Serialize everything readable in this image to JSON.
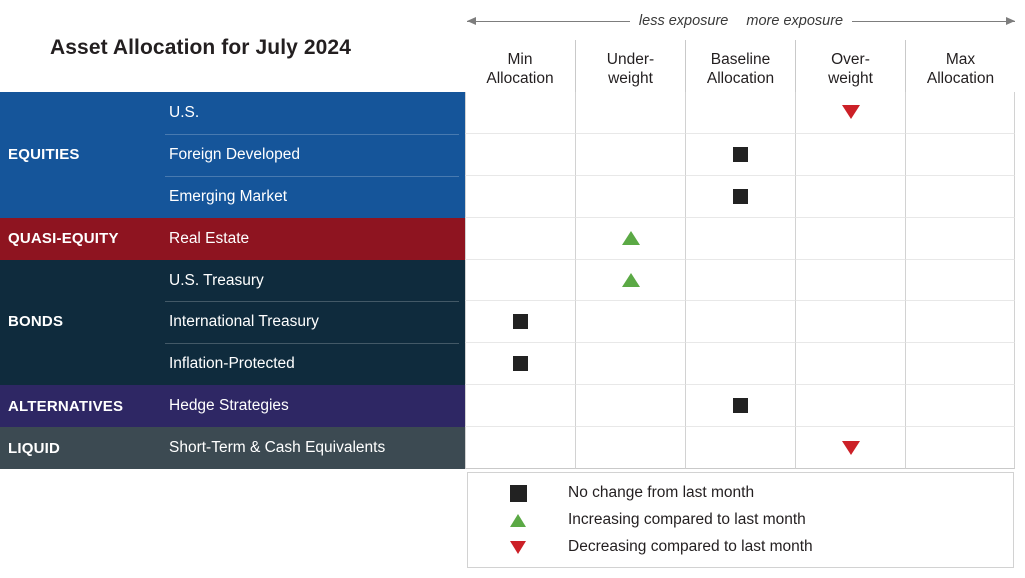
{
  "title": "Asset Allocation for July 2024",
  "scale": {
    "less_label": "less exposure",
    "more_label": "more exposure",
    "left_arrow_icon": "arrow-left-icon",
    "right_arrow_icon": "arrow-right-icon"
  },
  "columns": [
    {
      "line1": "Min",
      "line2": "Allocation"
    },
    {
      "line1": "Under-",
      "line2": "weight"
    },
    {
      "line1": "Baseline",
      "line2": "Allocation"
    },
    {
      "line1": "Over-",
      "line2": "weight"
    },
    {
      "line1": "Max",
      "line2": "Allocation"
    }
  ],
  "colors": {
    "equities": "#15559A",
    "quasi_equity": "#8E1420",
    "bonds": "#0F2B3D",
    "alternatives": "#2E2764",
    "liquid": "#3C4A52",
    "no_change": "#222222",
    "increasing": "#5BA945",
    "decreasing": "#CC2027"
  },
  "categories": [
    {
      "label": "EQUITIES",
      "color": "#15559A",
      "rows": 3
    },
    {
      "label": "QUASI-EQUITY",
      "color": "#8E1420",
      "rows": 1
    },
    {
      "label": "BONDS",
      "color": "#0F2B3D",
      "rows": 3
    },
    {
      "label": "ALTERNATIVES",
      "color": "#2E2764",
      "rows": 1
    },
    {
      "label": "LIQUID",
      "color": "#3C4A52",
      "rows": 1
    }
  ],
  "rows": [
    {
      "category": "EQUITIES",
      "asset": "U.S.",
      "column": 3,
      "marker": "decreasing",
      "first_of_group": true
    },
    {
      "category": "EQUITIES",
      "asset": "Foreign Developed",
      "column": 2,
      "marker": "no_change",
      "first_of_group": false
    },
    {
      "category": "EQUITIES",
      "asset": "Emerging Market",
      "column": 2,
      "marker": "no_change",
      "first_of_group": false
    },
    {
      "category": "QUASI-EQUITY",
      "asset": "Real Estate",
      "column": 1,
      "marker": "increasing",
      "first_of_group": true
    },
    {
      "category": "BONDS",
      "asset": "U.S. Treasury",
      "column": 1,
      "marker": "increasing",
      "first_of_group": true
    },
    {
      "category": "BONDS",
      "asset": "International Treasury",
      "column": 0,
      "marker": "no_change",
      "first_of_group": false
    },
    {
      "category": "BONDS",
      "asset": "Inflation-Protected",
      "column": 0,
      "marker": "no_change",
      "first_of_group": false
    },
    {
      "category": "ALTERNATIVES",
      "asset": "Hedge Strategies",
      "column": 2,
      "marker": "no_change",
      "first_of_group": true
    },
    {
      "category": "LIQUID",
      "asset": "Short-Term & Cash Equivalents",
      "column": 3,
      "marker": "decreasing",
      "first_of_group": true
    }
  ],
  "legend": [
    {
      "marker": "no_change",
      "label": "No change from last month"
    },
    {
      "marker": "increasing",
      "label": "Increasing compared to last month"
    },
    {
      "marker": "decreasing",
      "label": "Decreasing compared to last month"
    }
  ],
  "chart_data": {
    "type": "table",
    "title": "Asset Allocation for July 2024",
    "categories": [
      "Min Allocation",
      "Under-weight",
      "Baseline Allocation",
      "Over-weight",
      "Max Allocation"
    ],
    "xlabel": "less exposure ↔ more exposure",
    "ylabel": "",
    "grid": true,
    "legend_position": "bottom-right",
    "values": [
      {
        "group": "EQUITIES",
        "asset": "U.S.",
        "position": "Over-weight",
        "change": "Decreasing compared to last month"
      },
      {
        "group": "EQUITIES",
        "asset": "Foreign Developed",
        "position": "Baseline Allocation",
        "change": "No change from last month"
      },
      {
        "group": "EQUITIES",
        "asset": "Emerging Market",
        "position": "Baseline Allocation",
        "change": "No change from last month"
      },
      {
        "group": "QUASI-EQUITY",
        "asset": "Real Estate",
        "position": "Under-weight",
        "change": "Increasing compared to last month"
      },
      {
        "group": "BONDS",
        "asset": "U.S. Treasury",
        "position": "Under-weight",
        "change": "Increasing compared to last month"
      },
      {
        "group": "BONDS",
        "asset": "International Treasury",
        "position": "Min Allocation",
        "change": "No change from last month"
      },
      {
        "group": "BONDS",
        "asset": "Inflation-Protected",
        "position": "Min Allocation",
        "change": "No change from last month"
      },
      {
        "group": "ALTERNATIVES",
        "asset": "Hedge Strategies",
        "position": "Baseline Allocation",
        "change": "No change from last month"
      },
      {
        "group": "LIQUID",
        "asset": "Short-Term & Cash Equivalents",
        "position": "Over-weight",
        "change": "Decreasing compared to last month"
      }
    ]
  }
}
